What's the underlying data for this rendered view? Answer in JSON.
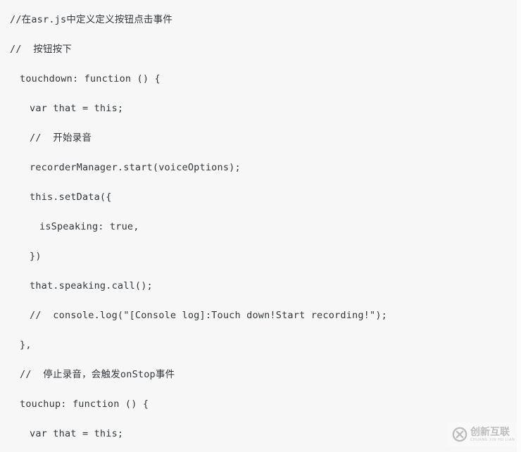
{
  "code_block": {
    "language": "javascript",
    "background_color": "#f7f7f7",
    "text_color": "#31383d",
    "lines": [
      {
        "indent": 0,
        "text": "//在asr.js中定义定义按钮点击事件"
      },
      {
        "indent": 0,
        "text": "//  按钮按下"
      },
      {
        "indent": 1,
        "text": "touchdown: function () {"
      },
      {
        "indent": 2,
        "text": "var that = this;"
      },
      {
        "indent": 2,
        "text": "//  开始录音"
      },
      {
        "indent": 2,
        "text": "recorderManager.start(voiceOptions);"
      },
      {
        "indent": 2,
        "text": "this.setData({"
      },
      {
        "indent": 3,
        "text": "isSpeaking: true,"
      },
      {
        "indent": 2,
        "text": "})"
      },
      {
        "indent": 2,
        "text": "that.speaking.call();"
      },
      {
        "indent": 2,
        "text": "//  console.log(\"[Console log]:Touch down!Start recording!\");"
      },
      {
        "indent": 1,
        "text": "},"
      },
      {
        "indent": 1,
        "text": "//  停止录音，会触发onStop事件"
      },
      {
        "indent": 1,
        "text": "touchup: function () {"
      },
      {
        "indent": 2,
        "text": "var that = this;"
      }
    ]
  },
  "watermark": {
    "brand_cn": "创新互联",
    "brand_pinyin": "CHUANG XIN HU LIAN",
    "logo_color": "#b9b9b9",
    "text_color": "#b9b9b9"
  }
}
